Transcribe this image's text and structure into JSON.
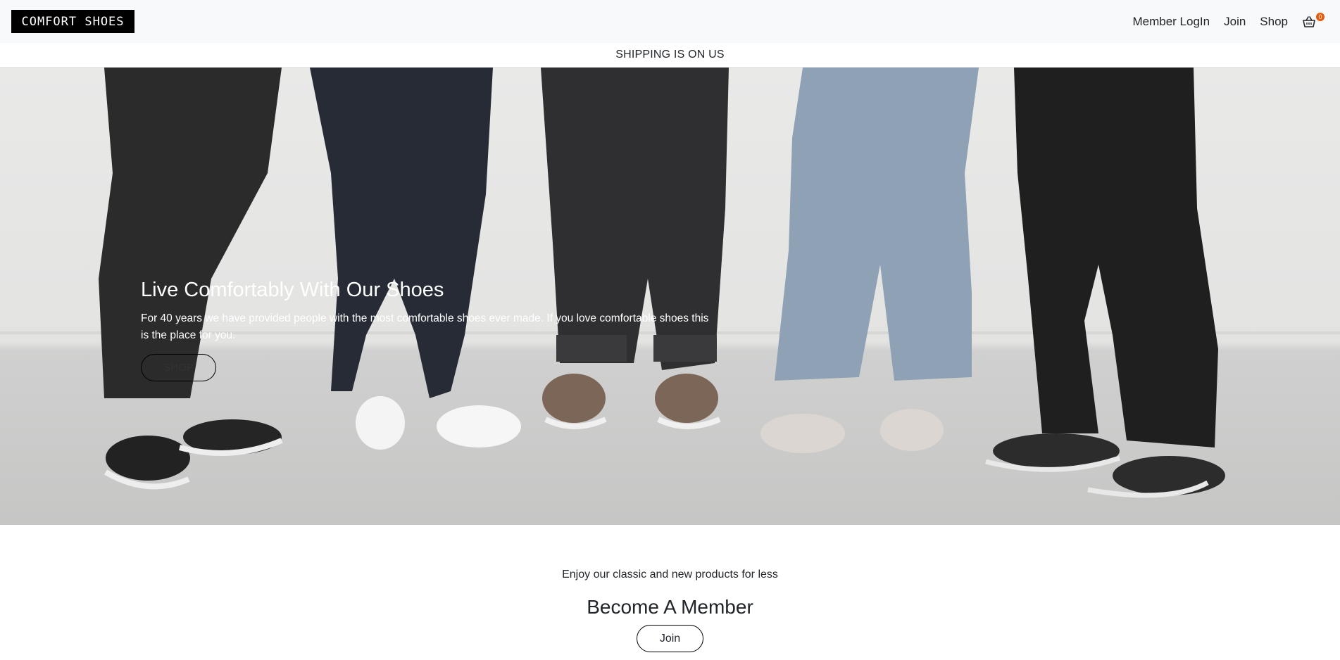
{
  "header": {
    "brand": "COMFORT SHOES",
    "nav": [
      {
        "label": "Member LogIn"
      },
      {
        "label": "Join"
      },
      {
        "label": "Shop"
      }
    ],
    "cart": {
      "icon": "basket-icon",
      "count": "0",
      "badge_color": "#e8590c"
    }
  },
  "announcement": {
    "text": "SHIPPING IS ON US"
  },
  "hero": {
    "title": "Live Comfortably With Our Shoes",
    "text": "For 40 years we have provided people with the most comfortable shoes ever made. If you love comfortable shoes this is the place for you.",
    "button_label": "SHOP"
  },
  "member": {
    "subtitle": "Enjoy our classic and new products for less",
    "title": "Become A Member",
    "button_label": "Join"
  },
  "colors": {
    "brand_bg": "#000000",
    "navbar_bg": "#f8f9fa",
    "text": "#212529"
  }
}
